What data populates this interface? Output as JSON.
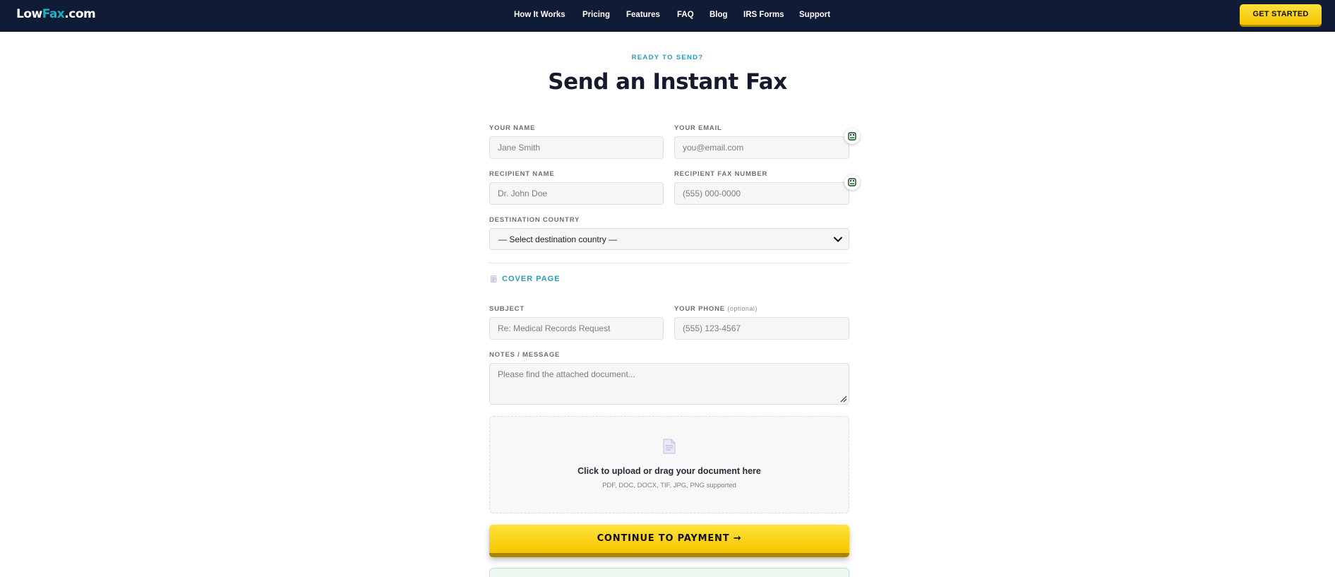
{
  "brand": {
    "name_part1": "Low",
    "name_part2": "Fax",
    "name_part3": ".com",
    "accent_color": "#1bb3c4",
    "nav_bg": "#101c36"
  },
  "nav": {
    "items": [
      {
        "label": "How It Works"
      },
      {
        "label": "Pricing"
      },
      {
        "label": "Features"
      },
      {
        "label": "FAQ"
      },
      {
        "label": "Blog"
      },
      {
        "label": "IRS Forms"
      },
      {
        "label": "Support"
      }
    ],
    "cta": "GET STARTED"
  },
  "hero": {
    "eyebrow": "READY TO SEND?",
    "title": "Send an Instant Fax"
  },
  "form": {
    "your_name": {
      "label": "YOUR NAME",
      "placeholder": "Jane Smith"
    },
    "your_email": {
      "label": "YOUR EMAIL",
      "placeholder": "you@email.com"
    },
    "recipient_name": {
      "label": "RECIPIENT NAME",
      "placeholder": "Dr. John Doe"
    },
    "recipient_fax": {
      "label": "RECIPIENT FAX NUMBER",
      "placeholder": "(555) 000-0000"
    },
    "destination_country": {
      "label": "DESTINATION COUNTRY",
      "selected": "— Select destination country —"
    },
    "cover_page": {
      "label": "COVER PAGE",
      "icon": "document-icon"
    },
    "subject": {
      "label": "SUBJECT",
      "placeholder": "Re: Medical Records Request"
    },
    "your_phone": {
      "label": "YOUR PHONE",
      "optional": "(optional)",
      "placeholder": "(555) 123-4567"
    },
    "notes": {
      "label": "NOTES / MESSAGE",
      "placeholder": "Please find the attached document..."
    },
    "upload": {
      "icon": "document-icon",
      "title": "Click to upload or drag your document here",
      "formats": "PDF, DOC, DOCX, TIF, JPG, PNG supported"
    },
    "submit": "CONTINUE TO PAYMENT →",
    "submit_color": "#f6c500"
  }
}
